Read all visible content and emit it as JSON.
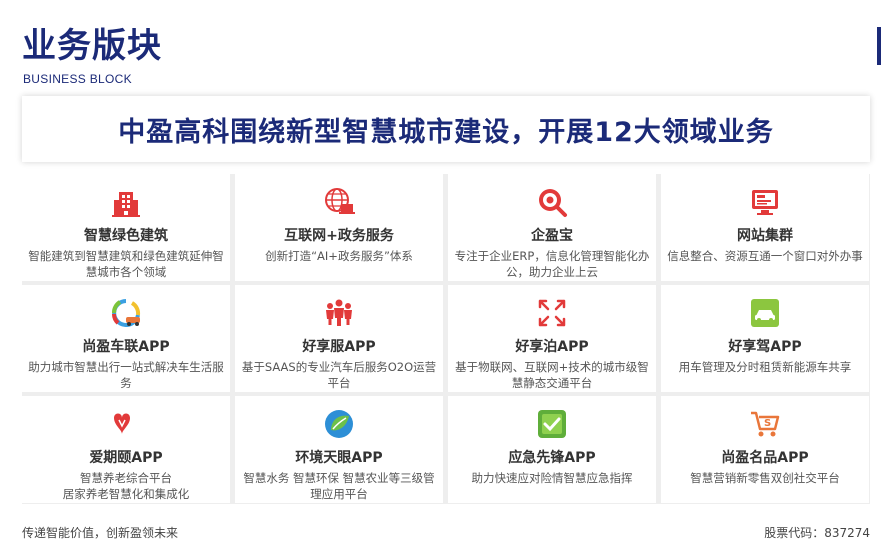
{
  "header": {
    "title": "业务版块",
    "subtitle": "BUSINESS BLOCK"
  },
  "headline": "中盈高科围绕新型智慧城市建设，开展12大领域业务",
  "colors": {
    "navy": "#1b2a78",
    "red": "#e23a3a",
    "orange": "#e9763a"
  },
  "cards": [
    {
      "name": "智慧绿色建筑",
      "desc": "智能建筑到智慧建筑和绿色建筑延伸智慧城市各个领域",
      "icon": "building-icon"
    },
    {
      "name": "互联网+政务服务",
      "desc": "创新打造“AI+政务服务”体系",
      "icon": "globe-laptop-icon"
    },
    {
      "name": "企盈宝",
      "desc": "专注于企业ERP，信息化管理智能化办公，助力企业上云",
      "icon": "target-search-icon"
    },
    {
      "name": "网站集群",
      "desc": "信息整合、资源互通一个窗口对外办事",
      "icon": "monitor-icon"
    },
    {
      "name": "尚盈车联APP",
      "desc": "助力城市智慧出行一站式解决车生活服务",
      "icon": "car-app-icon"
    },
    {
      "name": "好享服APP",
      "desc": "基于SAAS的专业汽车后服务O2O运营平台",
      "icon": "people-icon"
    },
    {
      "name": "好享泊APP",
      "desc": "基于物联网、互联网+技术的城市级智慧静态交通平台",
      "icon": "parking-arrows-icon"
    },
    {
      "name": "好享驾APP",
      "desc": "用车管理及分时租赁新能源车共享",
      "icon": "green-car-icon"
    },
    {
      "name": "爱期颐APP",
      "desc": "智慧养老综合平台\n居家养老智慧化和集成化",
      "icon": "aiqiyi-logo-icon"
    },
    {
      "name": "环境天眼APP",
      "desc": "智慧水务 智慧环保 智慧农业等三级管理应用平台",
      "icon": "earth-leaf-icon"
    },
    {
      "name": "应急先锋APP",
      "desc": "助力快速应对险情智慧应急指挥",
      "icon": "check-app-icon"
    },
    {
      "name": "尚盈名品APP",
      "desc": "智慧营销新零售双创社交平台",
      "icon": "shopping-cart-icon"
    }
  ],
  "footer": {
    "slogan": "传递智能价值，创新盈领未来",
    "stock": "股票代码：837274"
  }
}
